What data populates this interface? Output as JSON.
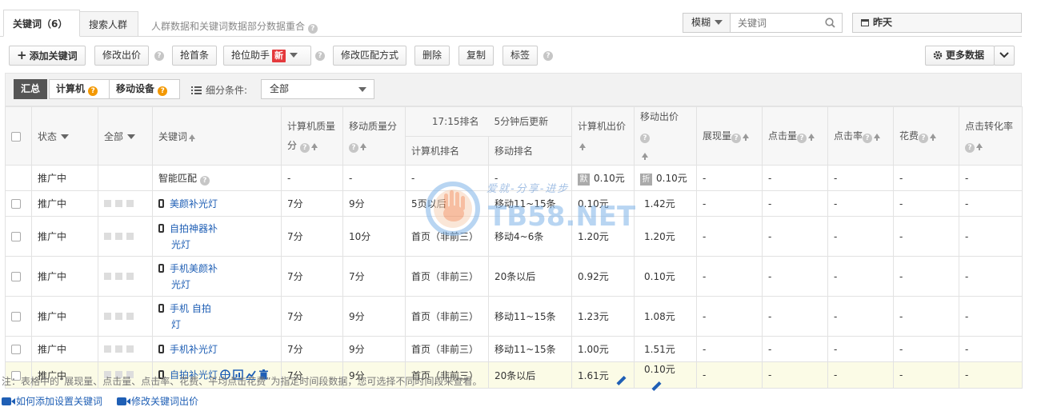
{
  "tabs": [
    {
      "label": "关键词（6）",
      "active": true
    },
    {
      "label": "搜索人群",
      "active": false
    }
  ],
  "tab_note": "人群数据和关键词数据部分数据重合",
  "search": {
    "mode": "模糊",
    "placeholder": "关键词"
  },
  "date_select": "昨天",
  "toolbar": {
    "add": "添加关键词",
    "modify_price": "修改出价",
    "grab_first": "抢首条",
    "rank_helper": "抢位助手",
    "new_badge": "新",
    "modify_match": "修改匹配方式",
    "delete": "删除",
    "copy": "复制",
    "tag": "标签",
    "more_data": "更多数据"
  },
  "filters": {
    "segments": [
      "汇总",
      "计算机",
      "移动设备"
    ],
    "condition_label": "细分条件:",
    "condition_value": "全部"
  },
  "header": {
    "status": "状态",
    "all": "全部",
    "keyword": "关键词",
    "pc_quality": "计算机质量",
    "pc_quality_2": "分",
    "mobile_quality": "移动质量分",
    "rank_time": "17:15排名",
    "rank_update": "5分钟后更新",
    "pc_rank": "计算机排名",
    "mobile_rank": "移动排名",
    "pc_bid": "计算机出价",
    "mobile_bid": "移动出价",
    "impressions": "展现量",
    "clicks": "点击量",
    "ctr": "点击率",
    "cost": "花费",
    "conversion": "点击转化率"
  },
  "smart_row": {
    "status": "推广中",
    "keyword": "智能匹配",
    "pc_quality": "-",
    "mobile_quality": "-",
    "pc_rank": "-",
    "mobile_rank": "-",
    "pc_bid_tag": "默",
    "pc_bid": "0.10元",
    "mobile_bid_tag": "折",
    "mobile_bid": "0.10元",
    "impressions": "-",
    "clicks": "-",
    "ctr": "-",
    "cost": "-",
    "conversion": "-"
  },
  "rows": [
    {
      "status": "推广中",
      "kw1": "美颜补光灯",
      "kw2": "",
      "pc_quality": "7分",
      "mobile_quality": "9分",
      "pc_rank": "5页以后",
      "mobile_rank": "移动11~15条",
      "pc_bid": "0.10元",
      "mobile_bid": "1.42元",
      "impressions": "-",
      "clicks": "-",
      "ctr": "-",
      "cost": "-",
      "conversion": "-"
    },
    {
      "status": "推广中",
      "kw1": "自拍神器补",
      "kw2": "光灯",
      "pc_quality": "7分",
      "mobile_quality": "10分",
      "pc_rank": "首页（非前三）",
      "mobile_rank": "移动4~6条",
      "pc_bid": "1.20元",
      "mobile_bid": "1.20元",
      "impressions": "-",
      "clicks": "-",
      "ctr": "-",
      "cost": "-",
      "conversion": "-"
    },
    {
      "status": "推广中",
      "kw1": "手机美颜补",
      "kw2": "光灯",
      "pc_quality": "7分",
      "mobile_quality": "7分",
      "pc_rank": "首页（非前三）",
      "mobile_rank": "20条以后",
      "pc_bid": "0.92元",
      "mobile_bid": "0.10元",
      "impressions": "-",
      "clicks": "-",
      "ctr": "-",
      "cost": "-",
      "conversion": "-"
    },
    {
      "status": "推广中",
      "kw1": "手机 自拍",
      "kw2": "灯",
      "pc_quality": "7分",
      "mobile_quality": "9分",
      "pc_rank": "首页（非前三）",
      "mobile_rank": "移动11~15条",
      "pc_bid": "1.23元",
      "mobile_bid": "1.08元",
      "impressions": "-",
      "clicks": "-",
      "ctr": "-",
      "cost": "-",
      "conversion": "-"
    },
    {
      "status": "推广中",
      "kw1": "手机补光灯",
      "kw2": "",
      "pc_quality": "7分",
      "mobile_quality": "9分",
      "pc_rank": "首页（非前三）",
      "mobile_rank": "移动11~15条",
      "pc_bid": "1.00元",
      "mobile_bid": "1.51元",
      "impressions": "-",
      "clicks": "-",
      "ctr": "-",
      "cost": "-",
      "conversion": "-"
    },
    {
      "status": "推广中",
      "kw1": "自拍补光灯",
      "kw2": "",
      "pc_quality": "7分",
      "mobile_quality": "9分",
      "pc_rank": "首页（非前三）",
      "mobile_rank": "20条以后",
      "pc_bid": "1.61元",
      "mobile_bid": "0.10元",
      "impressions": "-",
      "clicks": "-",
      "ctr": "-",
      "cost": "-",
      "conversion": "-"
    }
  ],
  "note": "注：表格中的“展现量、点击量、点击率、花费、平均点击花费”为指定时间段数据，您可选择不同时间段来查看。",
  "help_links": [
    "如何添加设置关键词",
    "修改关键词出价"
  ],
  "watermark": {
    "line1": "爱就-分享-进步",
    "line2": "TB58.NET"
  },
  "colors": {
    "status_green": "#3a9d00",
    "link_blue": "#1f5fb5",
    "new_red": "#e4393c",
    "help_orange": "#f39800"
  }
}
